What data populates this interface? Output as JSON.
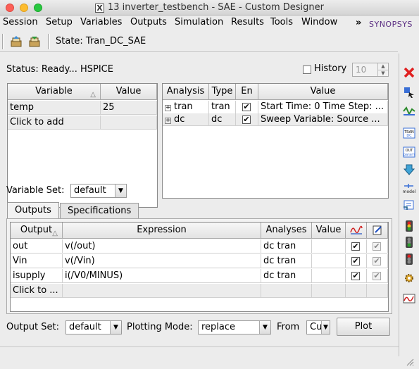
{
  "window": {
    "title": "13 inverter_testbench - SAE - Custom Designer"
  },
  "menu": {
    "items": [
      "Session",
      "Setup",
      "Variables",
      "Outputs",
      "Simulation",
      "Results",
      "Tools",
      "Window"
    ],
    "more": "»",
    "logo": "SYNOPSYS"
  },
  "toolbar": {
    "state_label": "State: Tran_DC_SAE"
  },
  "status": {
    "text": "Status: Ready... HSPICE"
  },
  "history": {
    "label": "History",
    "checked": false,
    "value": "10"
  },
  "variables_table": {
    "headers": [
      "Variable",
      "Value"
    ],
    "rows": [
      {
        "variable": "temp",
        "value": "25"
      },
      {
        "variable": "Click to add",
        "value": ""
      }
    ]
  },
  "analyses_table": {
    "headers": [
      "Analysis",
      "Type",
      "En",
      "Value"
    ],
    "rows": [
      {
        "analysis": "tran",
        "type": "tran",
        "enabled": true,
        "value": "Start Time: 0 Time Step: ..."
      },
      {
        "analysis": "dc",
        "type": "dc",
        "enabled": true,
        "value": "Sweep Variable: Source ..."
      }
    ]
  },
  "variable_set": {
    "label": "Variable Set:",
    "value": "default"
  },
  "tabs": [
    "Outputs",
    "Specifications"
  ],
  "outputs_table": {
    "headers": [
      "Output",
      "Expression",
      "Analyses",
      "Value"
    ],
    "rows": [
      {
        "output": "out",
        "expression": "v(/out)",
        "analyses": "dc tran",
        "value": "",
        "plot": true,
        "save": true
      },
      {
        "output": "Vin",
        "expression": "v(/Vin)",
        "analyses": "dc tran",
        "value": "",
        "plot": true,
        "save": true
      },
      {
        "output": "isupply",
        "expression": "i(/V0/MINUS)",
        "analyses": "dc tran",
        "value": "",
        "plot": true,
        "save": true
      },
      {
        "output": "Click to ...",
        "expression": "",
        "analyses": "",
        "value": ""
      }
    ]
  },
  "bottom": {
    "output_set_label": "Output Set:",
    "output_set_value": "default",
    "plotting_mode_label": "Plotting Mode:",
    "plotting_mode_value": "replace",
    "from_label": "From",
    "from_value": "Cu",
    "plot_button": "Plot"
  }
}
